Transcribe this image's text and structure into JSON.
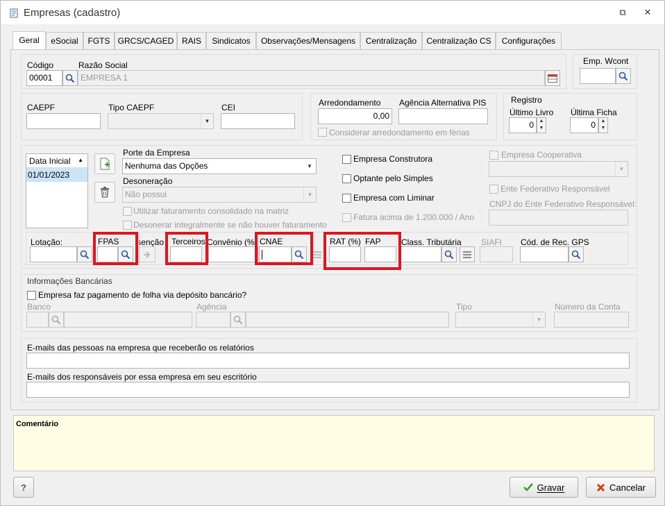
{
  "window": {
    "title": "Empresas (cadastro)",
    "minimize": "⧉",
    "close": "✕"
  },
  "tabs": [
    "Geral",
    "eSocial",
    "FGTS",
    "GRCS/CAGED",
    "RAIS",
    "Sindicatos",
    "Observações/Mensagens",
    "Centralização",
    "Centralização CS",
    "Configurações"
  ],
  "emp": {
    "codigo_label": "Código",
    "codigo_value": "00001",
    "razao_label": "Razão Social",
    "razao_value": "EMPRESA 1",
    "wcont_label": "Emp. Wcont"
  },
  "caepf": {
    "caepf_label": "CAEPF",
    "tipo_label": "Tipo CAEPF",
    "cei_label": "CEI"
  },
  "arred": {
    "label": "Arredondamento",
    "value": "0,00",
    "agencia_label": "Agência Alternativa PIS",
    "ferias_label": "Considerar arredondamento em férias"
  },
  "registro": {
    "title": "Registro",
    "livro_label": "Último Livro",
    "livro_value": "0",
    "ficha_label": "Última Ficha",
    "ficha_value": "0"
  },
  "periodo": {
    "header": "Data Inicial",
    "row": "01/01/2023"
  },
  "porte": {
    "label": "Porte da Empresa",
    "value": "Nenhuma das Opções",
    "deson_label": "Desoneração",
    "deson_value": "Não possui",
    "fat_label": "Utilizar faturamento consolidado na matriz",
    "desonerar_label": "Desonerar integralmente se não houver faturamento"
  },
  "checks": {
    "construtora": "Empresa Construtora",
    "simples": "Optante pelo Simples",
    "liminar": "Empresa com Liminar",
    "fatura": "Fatura acima de 1.200.000 / Ano",
    "cooperativa": "Empresa Cooperativa",
    "ente": "Ente Federativo Responsável",
    "cnpj_ente": "CNPJ do Ente Federativo Responsável:"
  },
  "row": {
    "lotacao": "Lotação:",
    "fpas": "FPAS",
    "isencao": "Isenção",
    "terceiros": "Terceiros",
    "convenio": "Convênio (%)",
    "cnae": "CNAE",
    "rat": "RAT (%)",
    "fap": "FAP",
    "class": "Class. Tributária",
    "siafi": "SIAFI",
    "gps": "Cód. de Rec. GPS"
  },
  "banco": {
    "title": "Informações Bancárias",
    "check": "Empresa faz pagamento de folha via depósito bancário?",
    "banco": "Banco",
    "agencia": "Agência",
    "tipo": "Tipo",
    "conta": "Número da Conta"
  },
  "emails": {
    "pessoas": "E-mails das pessoas na empresa que receberão os relatórios",
    "resp": "E-mails dos responsáveis por essa empresa em seu escritório"
  },
  "comentario": "Comentário",
  "buttons": {
    "help": "?",
    "gravar": "Gravar",
    "cancelar": "Cancelar"
  },
  "colors": {
    "highlight": "#e0141e",
    "comment_bg": "#fffde3"
  }
}
